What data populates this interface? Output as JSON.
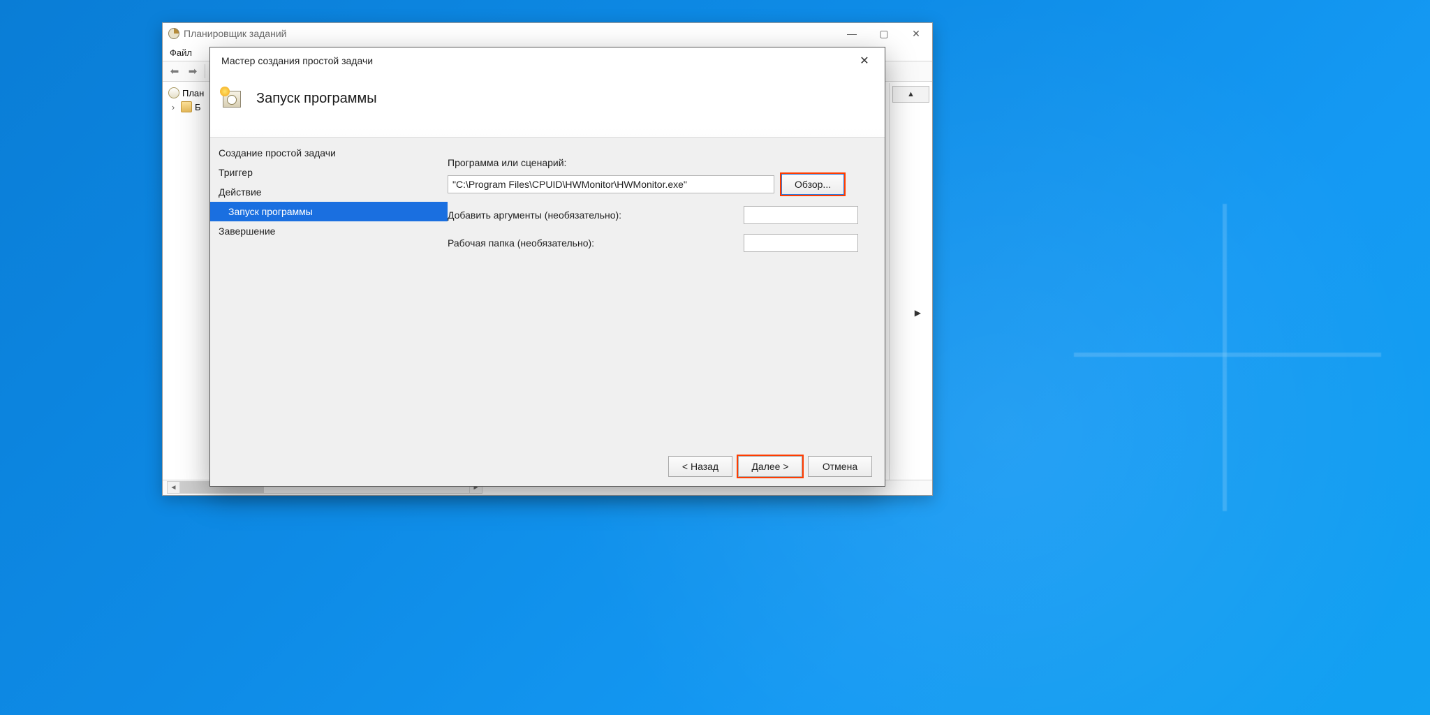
{
  "parent": {
    "title": "Планировщик заданий",
    "menu_file": "Файл",
    "tree": {
      "root": "План",
      "child": "Б"
    }
  },
  "wizard": {
    "title": "Мастер создания простой задачи",
    "heading": "Запуск программы",
    "steps": {
      "create": "Создание простой задачи",
      "trigger": "Триггер",
      "action": "Действие",
      "start_program": "Запуск программы",
      "finish": "Завершение"
    },
    "form": {
      "program_label": "Программа или сценарий:",
      "program_value": "\"C:\\Program Files\\CPUID\\HWMonitor\\HWMonitor.exe\"",
      "browse": "Обзор...",
      "args_label": "Добавить аргументы (необязательно):",
      "args_value": "",
      "workdir_label": "Рабочая папка (необязательно):",
      "workdir_value": ""
    },
    "buttons": {
      "back": "< Назад",
      "next": "Далее >",
      "cancel": "Отмена"
    }
  }
}
